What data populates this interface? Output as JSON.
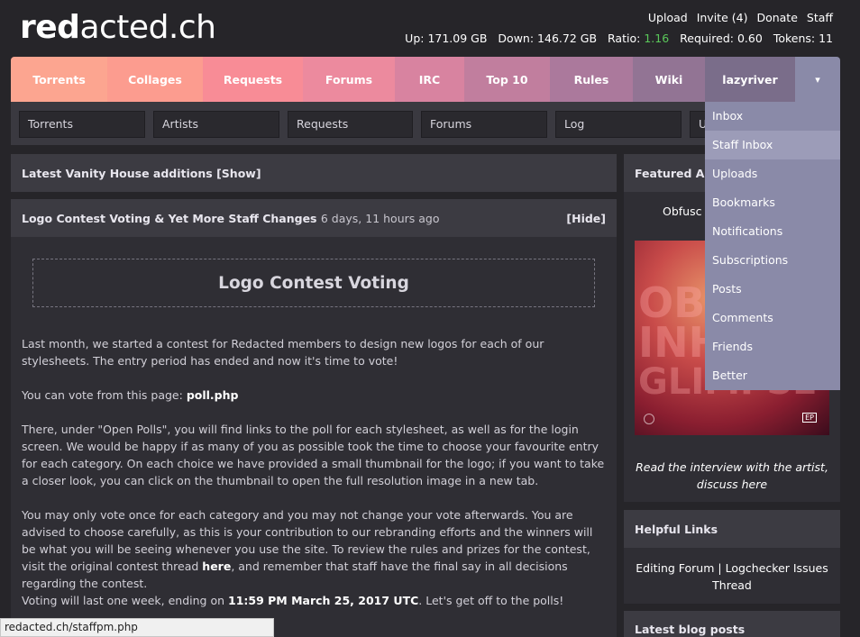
{
  "logo": {
    "bold": "red",
    "light": "acted.ch"
  },
  "userlinks": [
    "Upload",
    "Invite (4)",
    "Donate",
    "Staff"
  ],
  "stats": {
    "up_label": "Up:",
    "up": "171.09 GB",
    "down_label": "Down:",
    "down": "146.72 GB",
    "ratio_label": "Ratio:",
    "ratio": "1.16",
    "required_label": "Required:",
    "required": "0.60",
    "tokens_label": "Tokens:",
    "tokens": "11"
  },
  "nav": {
    "tabs": [
      "Torrents",
      "Collages",
      "Requests",
      "Forums",
      "IRC",
      "Top 10",
      "Rules",
      "Wiki",
      "lazyriver"
    ],
    "arrow": "▾"
  },
  "searchbar": [
    "Torrents",
    "Artists",
    "Requests",
    "Forums",
    "Log",
    "U"
  ],
  "vanity": {
    "title": "Latest Vanity House additions",
    "show": "[Show]"
  },
  "news": {
    "title": "Logo Contest Voting & Yet More Staff Changes",
    "age": "6 days, 11 hours ago",
    "hide": "[Hide]",
    "heading": "Logo Contest Voting",
    "p1": "Last month, we started a contest for Redacted members to design new logos for each of our stylesheets. The entry period has ended and now it's time to vote!",
    "p2_text": "You can vote from this page:",
    "p2_link": "poll.php",
    "p3": "There, under \"Open Polls\", you will find links to the poll for each stylesheet, as well as for the login screen. We would be happy if as many of you as possible took the time to choose your favourite entry for each category. On each choice we have provided a small thumbnail for the logo; if you want to take a closer look, you can click on the thumbnail to open the full resolution image in a new tab.",
    "p4_a": "You may only vote once for each category and you may not change your vote afterwards. You are advised to choose carefully, as this is your contribution to our rebranding efforts and the winners will be what you will be seeing whenever you use the site. To review the rules and prizes for the contest, visit the original contest thread",
    "p4_link": "here",
    "p4_b": ", and remember that staff have the final say in all decisions regarding the contest.",
    "p5_a": "Voting will last one week, ending on",
    "p5_bold": "11:59 PM March 25, 2017 UTC",
    "p5_b": ". Let's get off to the polls!"
  },
  "featured": {
    "title": "Featured Albu",
    "artist": "Obfusc",
    "art_lines": [
      "OB",
      "INH",
      "GLIMPSE"
    ],
    "art_badge": "EP",
    "caption_a": "Read the interview with the artist,",
    "caption_b": "discuss here"
  },
  "helpful": {
    "title": "Helpful Links",
    "links": [
      "Editing Forum",
      "Logchecker Issues",
      "Thread"
    ],
    "sep": "|"
  },
  "blog": {
    "title": "Latest blog posts"
  },
  "dropdown": [
    "Inbox",
    "Staff Inbox",
    "Uploads",
    "Bookmarks",
    "Notifications",
    "Subscriptions",
    "Posts",
    "Comments",
    "Friends",
    "Better"
  ],
  "status_url": "redacted.ch/staffpm.php",
  "colors": {
    "tabs": [
      "#fca590",
      "#fc9c8f",
      "#f88c96",
      "#ec8a9e",
      "#d883a0",
      "#c17e9e",
      "#ab799c",
      "#927494",
      "#7a6d8a",
      "#8a8aa8"
    ]
  }
}
